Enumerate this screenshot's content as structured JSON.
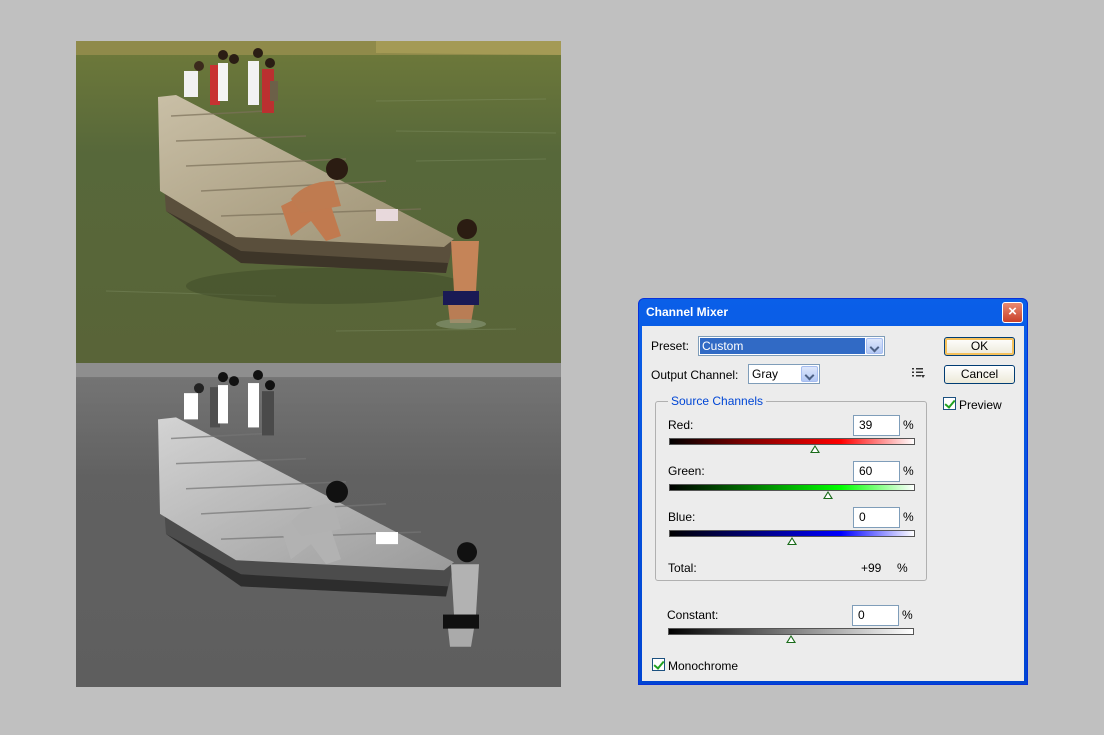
{
  "dialog": {
    "title": "Channel Mixer",
    "close_icon": "close-x-icon",
    "preset_label": "Preset:",
    "preset_value": "Custom",
    "output_channel_label": "Output Channel:",
    "output_channel_value": "Gray",
    "ok_label": "OK",
    "cancel_label": "Cancel",
    "preview_label": "Preview",
    "preview_checked": true,
    "source_channels_title": "Source Channels",
    "channels": [
      {
        "label": "Red:",
        "value": "39",
        "unit": "%",
        "slider_fraction": 0.595,
        "gradient_end": "#ff0000"
      },
      {
        "label": "Green:",
        "value": "60",
        "unit": "%",
        "slider_fraction": 0.645,
        "gradient_end": "#00ff00"
      },
      {
        "label": "Blue:",
        "value": "0",
        "unit": "%",
        "slider_fraction": 0.5,
        "gradient_end": "#0000ff"
      }
    ],
    "total_label": "Total:",
    "total_value": "+99",
    "total_unit": "%",
    "constant_label": "Constant:",
    "constant_value": "0",
    "constant_unit": "%",
    "constant_slider_fraction": 0.5,
    "monochrome_label": "Monochrome",
    "monochrome_checked": true
  },
  "colors": {
    "title_bar": "#0054e3",
    "selection": "#316ac5",
    "group_title": "#0046d5",
    "background": "#c0c0c0"
  }
}
